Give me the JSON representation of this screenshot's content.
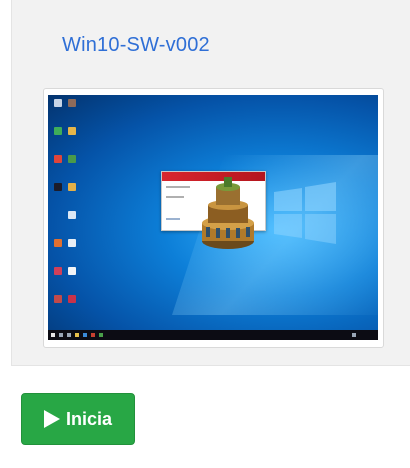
{
  "card": {
    "title": "Win10-SW-v002"
  },
  "preview": {
    "desktop_icons": [
      "recycle-bin-icon",
      "app-icon",
      "network-icon",
      "user-icon",
      "chrome-icon",
      "settings-icon",
      "firefox-icon",
      "app-icon",
      "folder-icon",
      "app-icon",
      "document-icon",
      "app-icon",
      "app-icon",
      "app-icon"
    ],
    "splash_app": "solidworks-splash",
    "colors": {
      "desktop": "#0a6fd0",
      "taskbar": "#0c0c14",
      "splash_bar": "#d8262e"
    }
  },
  "action": {
    "start_label": "Inicia",
    "button_color": "#28a745"
  }
}
